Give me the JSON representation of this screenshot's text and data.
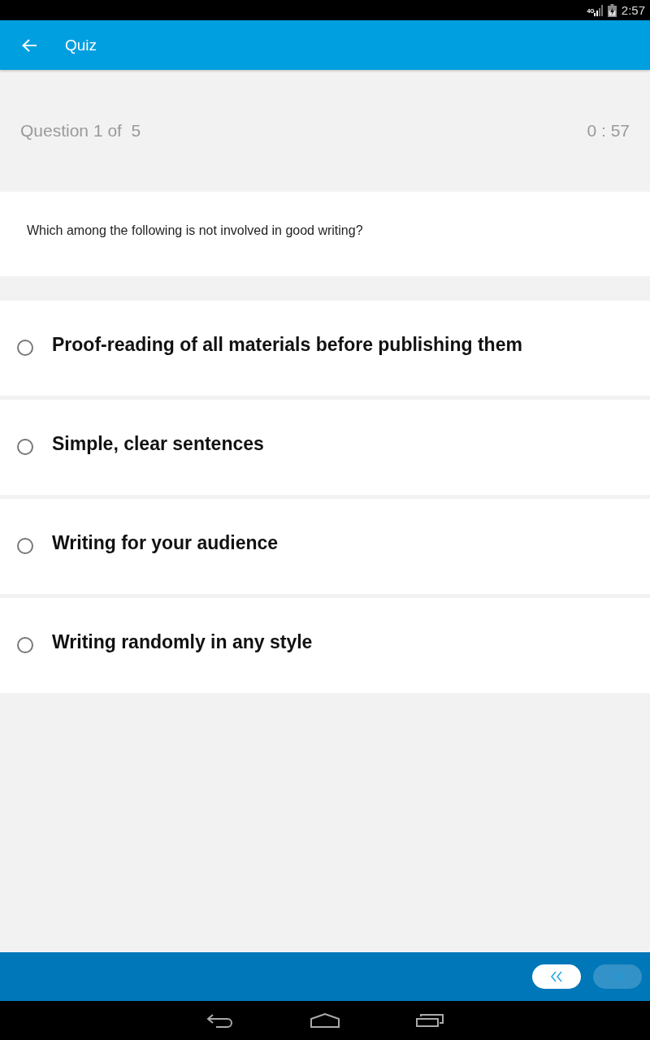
{
  "status_bar": {
    "network": "4G",
    "time": "2:57"
  },
  "app_bar": {
    "title": "Quiz"
  },
  "progress": {
    "label": "Question 1 of  5",
    "timer": "0 : 57"
  },
  "question": {
    "text": "Which among the following is not involved in good writing?"
  },
  "options": [
    {
      "text": "Proof-reading of all materials before publishing them",
      "selected": false
    },
    {
      "text": "Simple, clear sentences",
      "selected": false
    },
    {
      "text": "Writing for your audience",
      "selected": false
    },
    {
      "text": "Writing randomly in any style",
      "selected": false
    }
  ],
  "navigation": {
    "buttons": [
      {
        "kind": "previous",
        "disabled": false
      },
      {
        "kind": "next",
        "disabled": true
      }
    ]
  }
}
